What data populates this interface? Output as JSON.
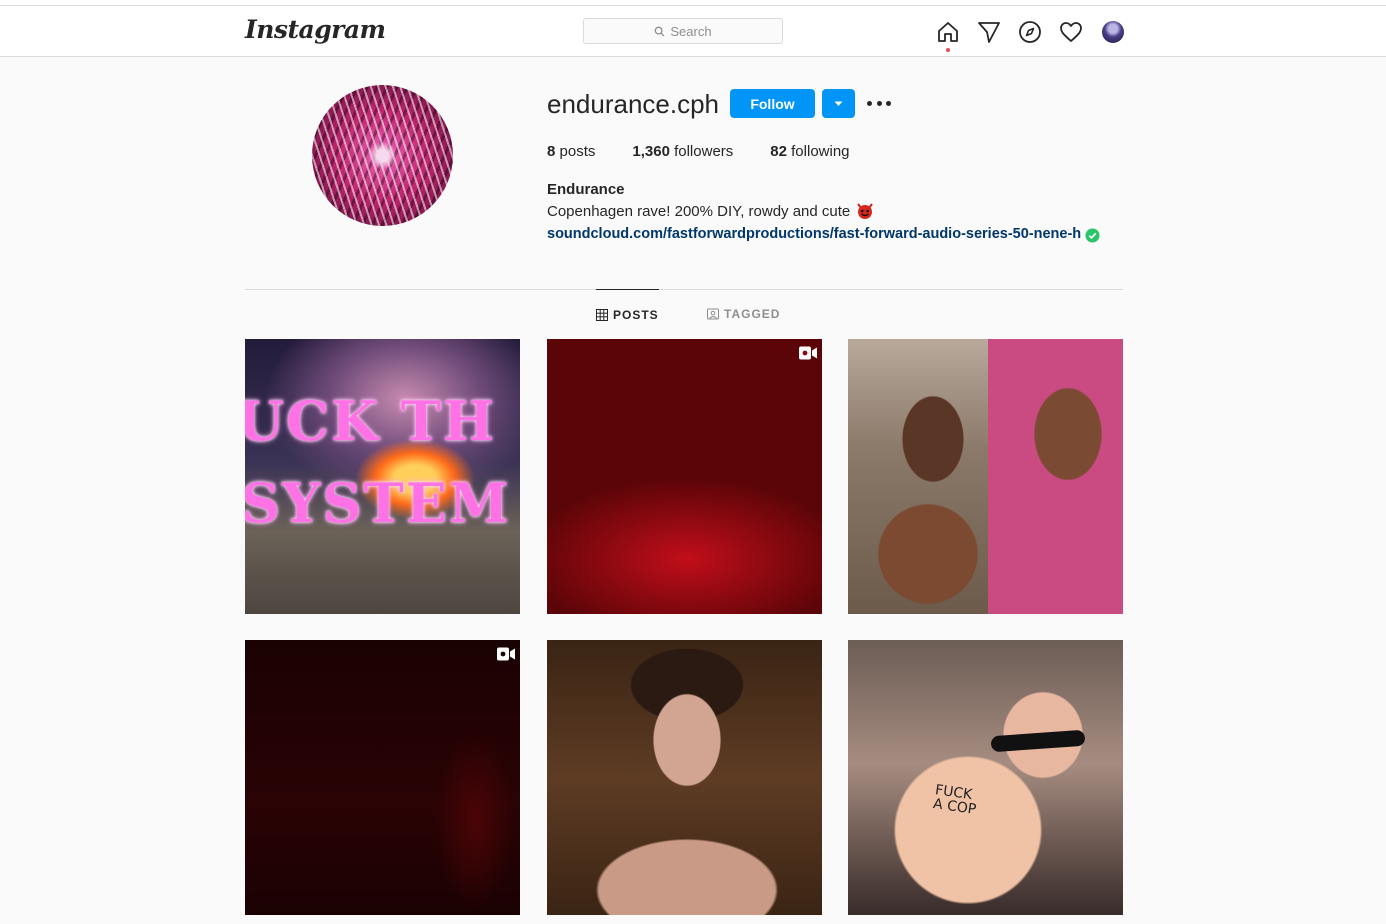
{
  "header": {
    "logo_text": "Instagram",
    "search_placeholder": "Search",
    "nav_icons": [
      "home-icon",
      "direct-icon",
      "explore-icon",
      "activity-heart-icon",
      "profile-avatar"
    ]
  },
  "profile": {
    "username": "endurance.cph",
    "follow_label": "Follow",
    "stats": {
      "posts_count": "8",
      "posts_label": "posts",
      "followers_count": "1,360",
      "followers_label": "followers",
      "following_count": "82",
      "following_label": "following"
    },
    "full_name": "Endurance",
    "bio": "Copenhagen rave! 200% DIY, rowdy and cute",
    "bio_emoji": "devil-face-icon",
    "link": "soundcloud.com/fastforwardproductions/fast-forward-audio-series-50-nene-h"
  },
  "tabs": [
    {
      "label": "POSTS",
      "icon": "grid-icon",
      "active": true
    },
    {
      "label": "TAGGED",
      "icon": "tagged-icon",
      "active": false
    }
  ],
  "posts": [
    {
      "type": "image",
      "overlay_text": [
        "UCK TH",
        "SYSTEM"
      ]
    },
    {
      "type": "video"
    },
    {
      "type": "image"
    },
    {
      "type": "video"
    },
    {
      "type": "image"
    },
    {
      "type": "image",
      "overlay_text": [
        "FUCK",
        "A COP"
      ]
    }
  ],
  "colors": {
    "accent_blue": "#0095f6",
    "link_blue": "#00376b",
    "notification_red": "#ed4956",
    "verified_green": "#2bc46a"
  }
}
